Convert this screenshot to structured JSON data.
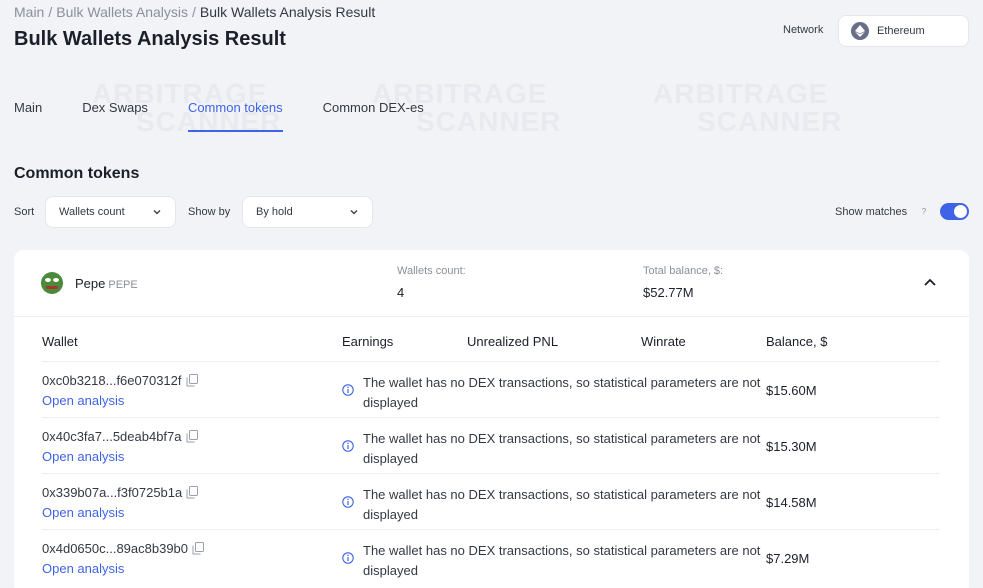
{
  "breadcrumb": {
    "items": [
      "Main",
      "Bulk Wallets Analysis"
    ],
    "current": "Bulk Wallets Analysis Result"
  },
  "page_title": "Bulk Wallets Analysis Result",
  "network": {
    "label": "Network",
    "value": "Ethereum"
  },
  "watermark": {
    "line1": "ARBITRAGE",
    "line2": "SCANNER"
  },
  "tabs": [
    {
      "label": "Main",
      "active": false
    },
    {
      "label": "Dex Swaps",
      "active": false
    },
    {
      "label": "Common tokens",
      "active": true
    },
    {
      "label": "Common DEX-es",
      "active": false
    }
  ],
  "section_title": "Common tokens",
  "filters": {
    "sort_label": "Sort",
    "sort_value": "Wallets count",
    "show_by_label": "Show by",
    "show_by_value": "By hold",
    "show_matches_label": "Show matches",
    "help": "?",
    "show_matches_on": true
  },
  "token": {
    "name": "Pepe",
    "symbol": "PEPE",
    "wallets_count_label": "Wallets count:",
    "wallets_count": "4",
    "total_balance_label": "Total balance, $:",
    "total_balance": "$52.77M"
  },
  "table": {
    "headers": [
      "Wallet",
      "Earnings",
      "Unrealized PNL",
      "Winrate",
      "Balance, $"
    ],
    "rows": [
      {
        "wallet": "0xc0b3218...f6e070312f",
        "link": "Open analysis",
        "message": "The wallet has no DEX transactions, so statistical parameters are not displayed",
        "balance": "$15.60M"
      },
      {
        "wallet": "0x40c3fa7...5deab4bf7a",
        "link": "Open analysis",
        "message": "The wallet has no DEX transactions, so statistical parameters are not displayed",
        "balance": "$15.30M"
      },
      {
        "wallet": "0x339b07a...f3f0725b1a",
        "link": "Open analysis",
        "message": "The wallet has no DEX transactions, so statistical parameters are not displayed",
        "balance": "$14.58M"
      },
      {
        "wallet": "0x4d0650c...89ac8b39b0",
        "link": "Open analysis",
        "message": "The wallet has no DEX transactions, so statistical parameters are not displayed",
        "balance": "$7.29M"
      }
    ]
  },
  "colors": {
    "accent": "#3f63e6",
    "background": "#f2f3f6",
    "card": "#ffffff"
  }
}
